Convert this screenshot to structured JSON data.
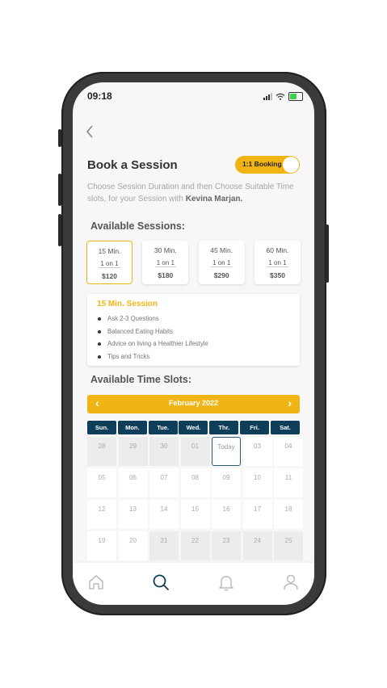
{
  "status_bar": {
    "time": "09:18"
  },
  "header": {
    "title": "Book a Session",
    "toggle_label": "1:1 Booking"
  },
  "description": {
    "text": "Choose Session Duration and then Choose Suitable Time slots, for your Session with ",
    "name": "Kevina Marjan."
  },
  "sessions_heading": "Available Sessions:",
  "sessions": [
    {
      "duration": "15 Min.",
      "type": "1 on 1",
      "price": "$120",
      "selected": true
    },
    {
      "duration": "30 Min.",
      "type": "1 on 1",
      "price": "$180",
      "selected": false
    },
    {
      "duration": "45 Min.",
      "type": "1 on 1",
      "price": "$290",
      "selected": false
    },
    {
      "duration": "60 Min.",
      "type": "1 on 1",
      "price": "$350",
      "selected": false
    }
  ],
  "session_detail": {
    "title": "15 Min. Session",
    "items": [
      "Ask 2-3 Questions",
      "Balanced Eating Habits",
      "Advice on living a Healthier Lifestyle",
      "Tips and Tricks"
    ]
  },
  "slots_heading": "Available Time Slots:",
  "calendar": {
    "month": "February 2022",
    "prev_icon": "chevron-left-icon",
    "next_icon": "chevron-right-icon",
    "weekdays": [
      "Sun.",
      "Mon.",
      "Tue.",
      "Wed.",
      "Thr.",
      "Fri.",
      "Sat."
    ],
    "cells": [
      {
        "label": "28",
        "state": "disabled"
      },
      {
        "label": "29",
        "state": "disabled"
      },
      {
        "label": "30",
        "state": "disabled"
      },
      {
        "label": "01",
        "state": "disabled"
      },
      {
        "label": "Today",
        "state": "today"
      },
      {
        "label": "03",
        "state": "available"
      },
      {
        "label": "04",
        "state": "available"
      },
      {
        "label": "05",
        "state": "available"
      },
      {
        "label": "06",
        "state": "available"
      },
      {
        "label": "07",
        "state": "available"
      },
      {
        "label": "08",
        "state": "available"
      },
      {
        "label": "09",
        "state": "available"
      },
      {
        "label": "10",
        "state": "available"
      },
      {
        "label": "11",
        "state": "available"
      },
      {
        "label": "12",
        "state": "available"
      },
      {
        "label": "13",
        "state": "available"
      },
      {
        "label": "14",
        "state": "available"
      },
      {
        "label": "15",
        "state": "available"
      },
      {
        "label": "16",
        "state": "available"
      },
      {
        "label": "17",
        "state": "available"
      },
      {
        "label": "18",
        "state": "available"
      },
      {
        "label": "19",
        "state": "available"
      },
      {
        "label": "20",
        "state": "available"
      },
      {
        "label": "21",
        "state": "disabled"
      },
      {
        "label": "22",
        "state": "disabled"
      },
      {
        "label": "23",
        "state": "disabled"
      },
      {
        "label": "24",
        "state": "disabled"
      },
      {
        "label": "25",
        "state": "disabled"
      }
    ]
  },
  "bottom_nav": [
    {
      "icon": "home-icon",
      "active": false
    },
    {
      "icon": "search-icon",
      "active": true
    },
    {
      "icon": "bell-icon",
      "active": false
    },
    {
      "icon": "profile-icon",
      "active": false
    }
  ],
  "colors": {
    "accent": "#f0b514",
    "navy": "#0f3e5a",
    "background": "#f7f7f7"
  }
}
